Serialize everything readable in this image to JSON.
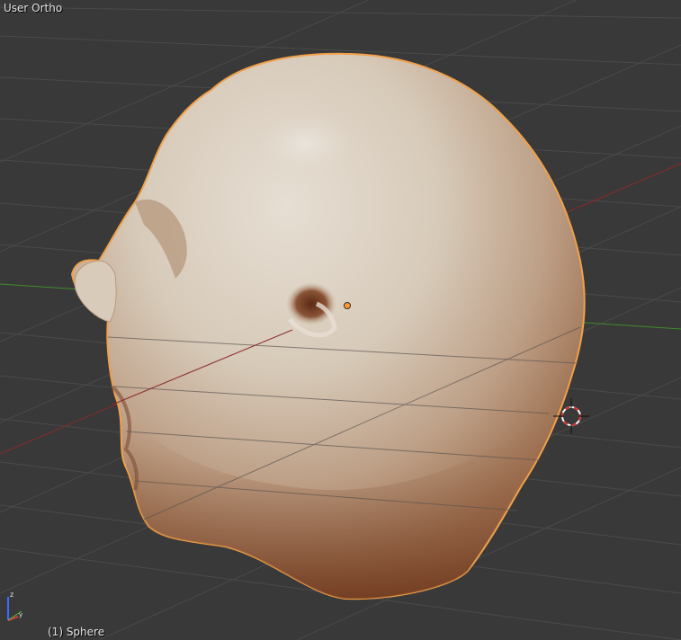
{
  "viewport": {
    "view_name": "User Ortho",
    "object_label": "(1) Sphere",
    "selected_object": "Sphere",
    "selected": true
  },
  "gizmo": {
    "axis_z_label": "z",
    "axis_y_label": "y",
    "axis_z_color": "#3b6bff",
    "axis_x_color": "#d04040",
    "axis_y_color": "#5bbf3a"
  },
  "colors": {
    "background": "#393939",
    "grid_line": "#4a4a4a",
    "x_axis": "#8a2a2a",
    "y_axis": "#3f8c2b",
    "selection_outline": "#f0a04a",
    "object_origin": "#ff9a3c",
    "cursor_red": "#d83030"
  },
  "icons": {
    "cursor": "3d-cursor-icon",
    "origin": "object-origin-icon",
    "gizmo": "axis-gizmo-icon"
  }
}
